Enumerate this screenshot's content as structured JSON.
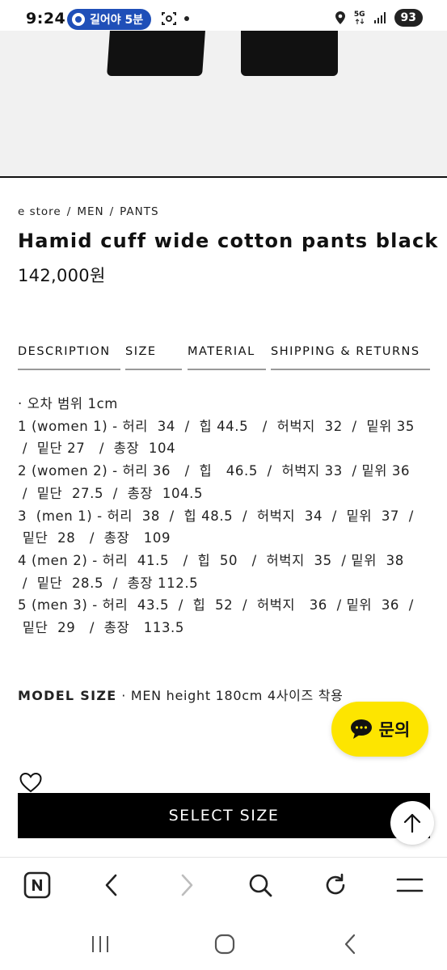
{
  "status_bar": {
    "time": "9:24",
    "navigation_pill": "길어야 5분",
    "network": "5G",
    "battery": "93"
  },
  "breadcrumb": [
    "e store",
    "/",
    "MEN",
    "/",
    "PANTS"
  ],
  "product": {
    "title": "Hamid cuff wide cotton pants black",
    "price": "142,000원"
  },
  "tabs": [
    {
      "label": "DESCRIPTION"
    },
    {
      "label": "SIZE"
    },
    {
      "label": "MATERIAL"
    },
    {
      "label": "SHIPPING & RETURNS"
    }
  ],
  "size_lines": [
    "· 오차 범위 1cm",
    "1 (women 1) - 허리  34  /  힙 44.5   /  허벅지  32  /  밑위 35",
    " /  밑단 27   /  총장  104",
    "2 (women 2) - 허리 36   /  힙   46.5  /  허벅지 33  / 밑위 36",
    " /  밑단  27.5  /  총장  104.5",
    "3  (men 1) - 허리  38  /  힙 48.5  /  허벅지  34  /  밑위  37  /",
    " 밑단  28   /  총장   109",
    "4 (men 2) - 허리  41.5   /  힙  50   /  허벅지  35  / 밑위  38",
    " /  밑단  28.5  /  총장 112.5",
    "5 (men 3) - 허리  43.5  /  힙  52  /  허벅지   36  / 밑위  36  /",
    " 밑단  29   /  총장   113.5"
  ],
  "model_size": {
    "label": "MODEL SIZE",
    "text": " · MEN height 180cm 4사이즈 착용"
  },
  "chat_button": {
    "label": "문의",
    "color": "#fde500"
  },
  "select_size_button": {
    "label": "SELECT SIZE"
  },
  "icons": {
    "heart": "heart-icon",
    "scroll_top": "arrow-up-icon",
    "browser_home": "naver-n-icon",
    "back": "chevron-left-icon",
    "forward": "chevron-right-icon",
    "search": "search-icon",
    "reload": "reload-icon",
    "menu": "menu-icon"
  }
}
